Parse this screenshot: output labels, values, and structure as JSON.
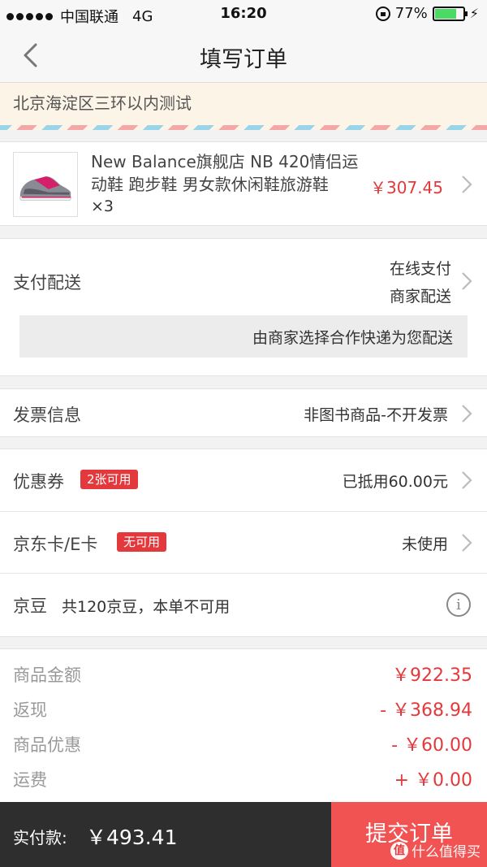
{
  "status_bar": {
    "carrier": "中国联通",
    "network": "4G",
    "time": "16:20",
    "battery": "77%",
    "battery_level": 0.77
  },
  "nav": {
    "title": "填写订单"
  },
  "address": {
    "text": "北京海淀区三环以内测试"
  },
  "product": {
    "name": "New Balance旗舰店 NB 420情侣运动鞋 跑步鞋 男女款休闲鞋旅游鞋",
    "qty": "×3",
    "price": "￥307.45"
  },
  "payment": {
    "label": "支付配送",
    "method": "在线支付",
    "delivery": "商家配送",
    "note": "由商家选择合作快递为您配送"
  },
  "invoice": {
    "label": "发票信息",
    "value": "非图书商品-不开发票"
  },
  "coupon": {
    "label": "优惠券",
    "badge": "2张可用",
    "value": "已抵用60.00元"
  },
  "jdcard": {
    "label": "京东卡/E卡",
    "badge": "无可用",
    "value": "未使用"
  },
  "jingdou": {
    "label": "京豆",
    "text": "共120京豆，本单不可用",
    "icon": "info-icon"
  },
  "summary": [
    {
      "label": "商品金额",
      "value": "￥922.35"
    },
    {
      "label": "返现",
      "value": "- ￥368.94"
    },
    {
      "label": "商品优惠",
      "value": "- ￥60.00"
    },
    {
      "label": "运费",
      "value": "+ ￥0.00"
    }
  ],
  "bottom": {
    "total_label": "实付款:",
    "total": "￥493.41",
    "submit": "提交订单"
  },
  "watermark": {
    "text": "什么值得买",
    "mark": "值"
  },
  "colors": {
    "accent": "#e4393c",
    "submit": "#f15353",
    "bottom_bar": "#2e2e2e"
  }
}
